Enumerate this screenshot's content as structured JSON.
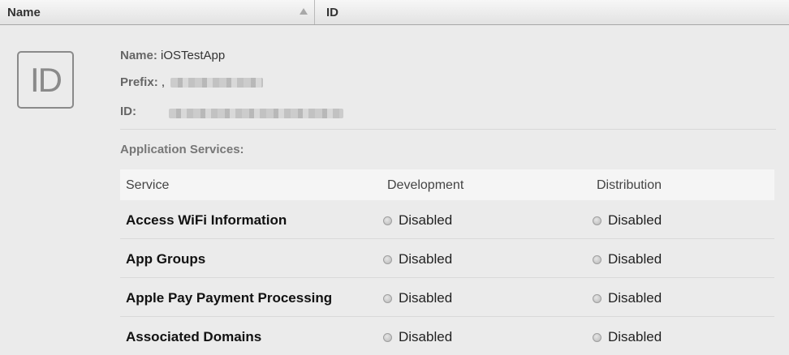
{
  "header": {
    "name_label": "Name",
    "id_label": "ID"
  },
  "app": {
    "icon_text": "ID",
    "name_label": "Name:",
    "name_value": "iOSTestApp",
    "prefix_label": "Prefix:",
    "prefix_value": ",",
    "id_label": "ID:"
  },
  "services": {
    "title": "Application Services:",
    "columns": [
      "Service",
      "Development",
      "Distribution"
    ],
    "rows": [
      {
        "service": "Access WiFi Information",
        "development": "Disabled",
        "distribution": "Disabled"
      },
      {
        "service": "App Groups",
        "development": "Disabled",
        "distribution": "Disabled"
      },
      {
        "service": "Apple Pay Payment Processing",
        "development": "Disabled",
        "distribution": "Disabled"
      },
      {
        "service": "Associated Domains",
        "development": "Disabled",
        "distribution": "Disabled"
      }
    ]
  },
  "colors": {
    "status_disabled": "#c8c8c8",
    "background": "#ebebeb"
  }
}
